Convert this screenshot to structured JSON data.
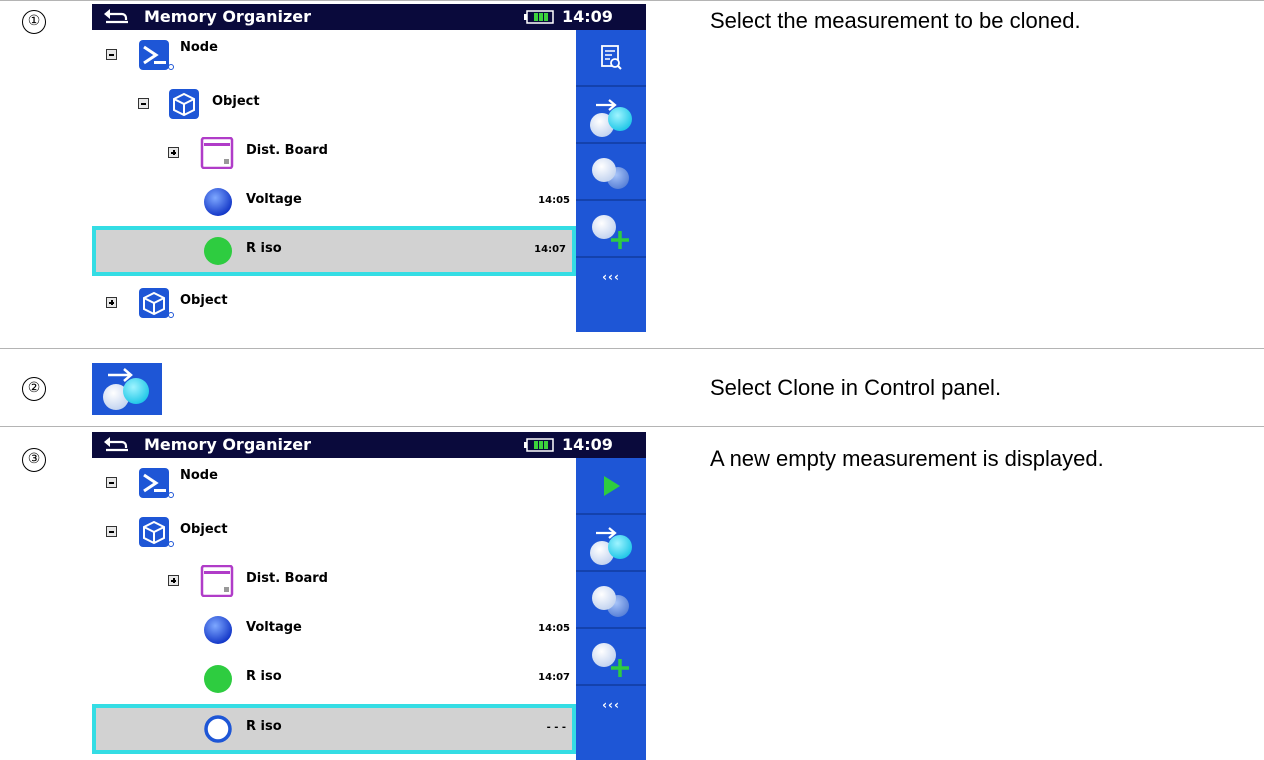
{
  "steps": [
    {
      "num": "①",
      "description": "Select the measurement to be cloned."
    },
    {
      "num": "②",
      "description": "Select Clone in Control panel."
    },
    {
      "num": "③",
      "description": "A new empty measurement is displayed."
    }
  ],
  "screen": {
    "title": "Memory Organizer",
    "clock": "14:09"
  },
  "screen1": {
    "items": [
      {
        "label": "Node",
        "time": ""
      },
      {
        "label": "Object",
        "time": ""
      },
      {
        "label": "Dist. Board",
        "time": ""
      },
      {
        "label": "Voltage",
        "time": "14:05"
      },
      {
        "label": "R iso",
        "time": "14:07"
      },
      {
        "label": "Object",
        "time": ""
      }
    ],
    "panel_more": "‹‹‹"
  },
  "screen3": {
    "items": [
      {
        "label": "Node",
        "time": ""
      },
      {
        "label": "Object",
        "time": ""
      },
      {
        "label": "Dist. Board",
        "time": ""
      },
      {
        "label": "Voltage",
        "time": "14:05"
      },
      {
        "label": "R iso",
        "time": "14:07"
      },
      {
        "label": "R iso",
        "time": "- - -"
      }
    ],
    "panel_more": "‹‹‹"
  },
  "colors": {
    "titlebar": "#0a0a3c",
    "panel": "#1e56d6",
    "selection_border": "#34dde4",
    "selection_fill": "#d2d2d2"
  },
  "icons": [
    "back-icon",
    "battery-icon",
    "node-icon",
    "object-icon",
    "dist-board-icon",
    "voltage-result-icon",
    "riso-pass-icon",
    "riso-empty-icon",
    "view-icon",
    "clone-icon",
    "clone-measurement-icon",
    "add-measurement-icon",
    "start-icon",
    "more-icon"
  ]
}
